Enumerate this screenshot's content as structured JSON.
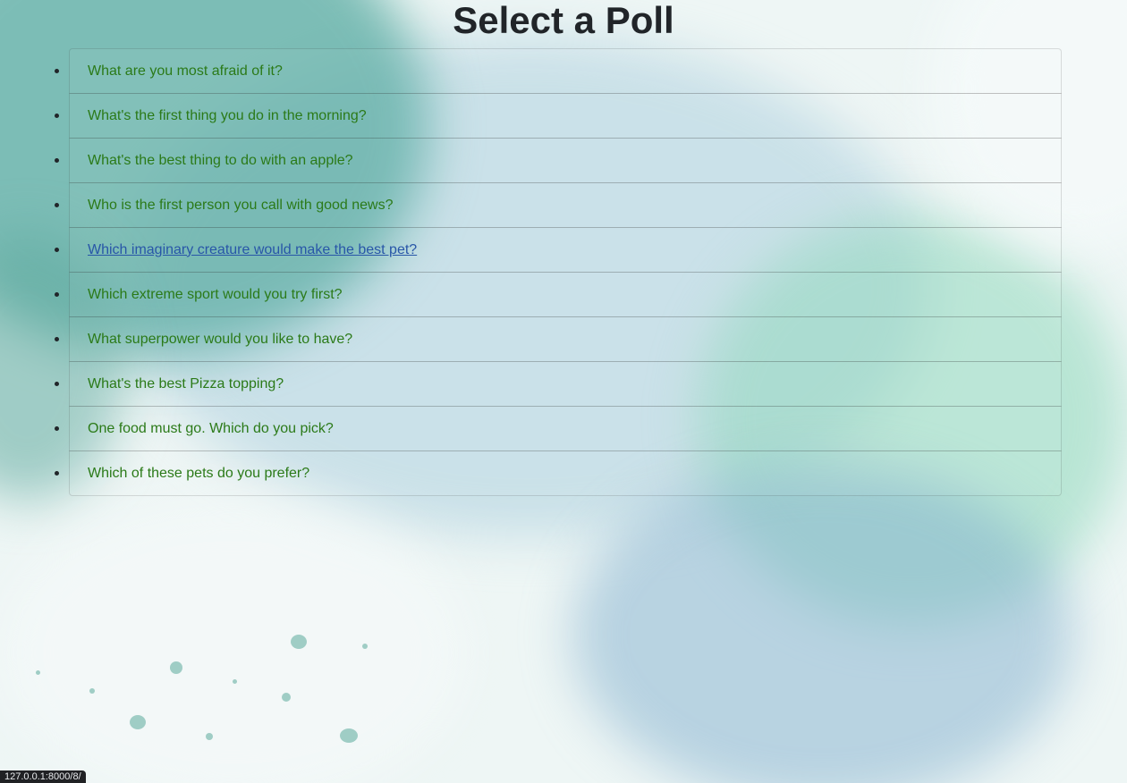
{
  "page": {
    "title": "Select a Poll"
  },
  "polls": [
    {
      "question": "What are you most afraid of it?",
      "hovered": false
    },
    {
      "question": "What's the first thing you do in the morning?",
      "hovered": false
    },
    {
      "question": "What's the best thing to do with an apple?",
      "hovered": false
    },
    {
      "question": "Who is the first person you call with good news?",
      "hovered": false
    },
    {
      "question": "Which imaginary creature would make the best pet?",
      "hovered": true
    },
    {
      "question": "Which extreme sport would you try first?",
      "hovered": false
    },
    {
      "question": "What superpower would you like to have?",
      "hovered": false
    },
    {
      "question": "What's the best Pizza topping?",
      "hovered": false
    },
    {
      "question": "One food must go. Which do you pick?",
      "hovered": false
    },
    {
      "question": "Which of these pets do you prefer?",
      "hovered": false
    }
  ],
  "status_bar": {
    "url": "127.0.0.1:8000/8/"
  },
  "colors": {
    "link": "#2b7a18",
    "link_hover": "#2856a8",
    "heading": "#212529"
  }
}
